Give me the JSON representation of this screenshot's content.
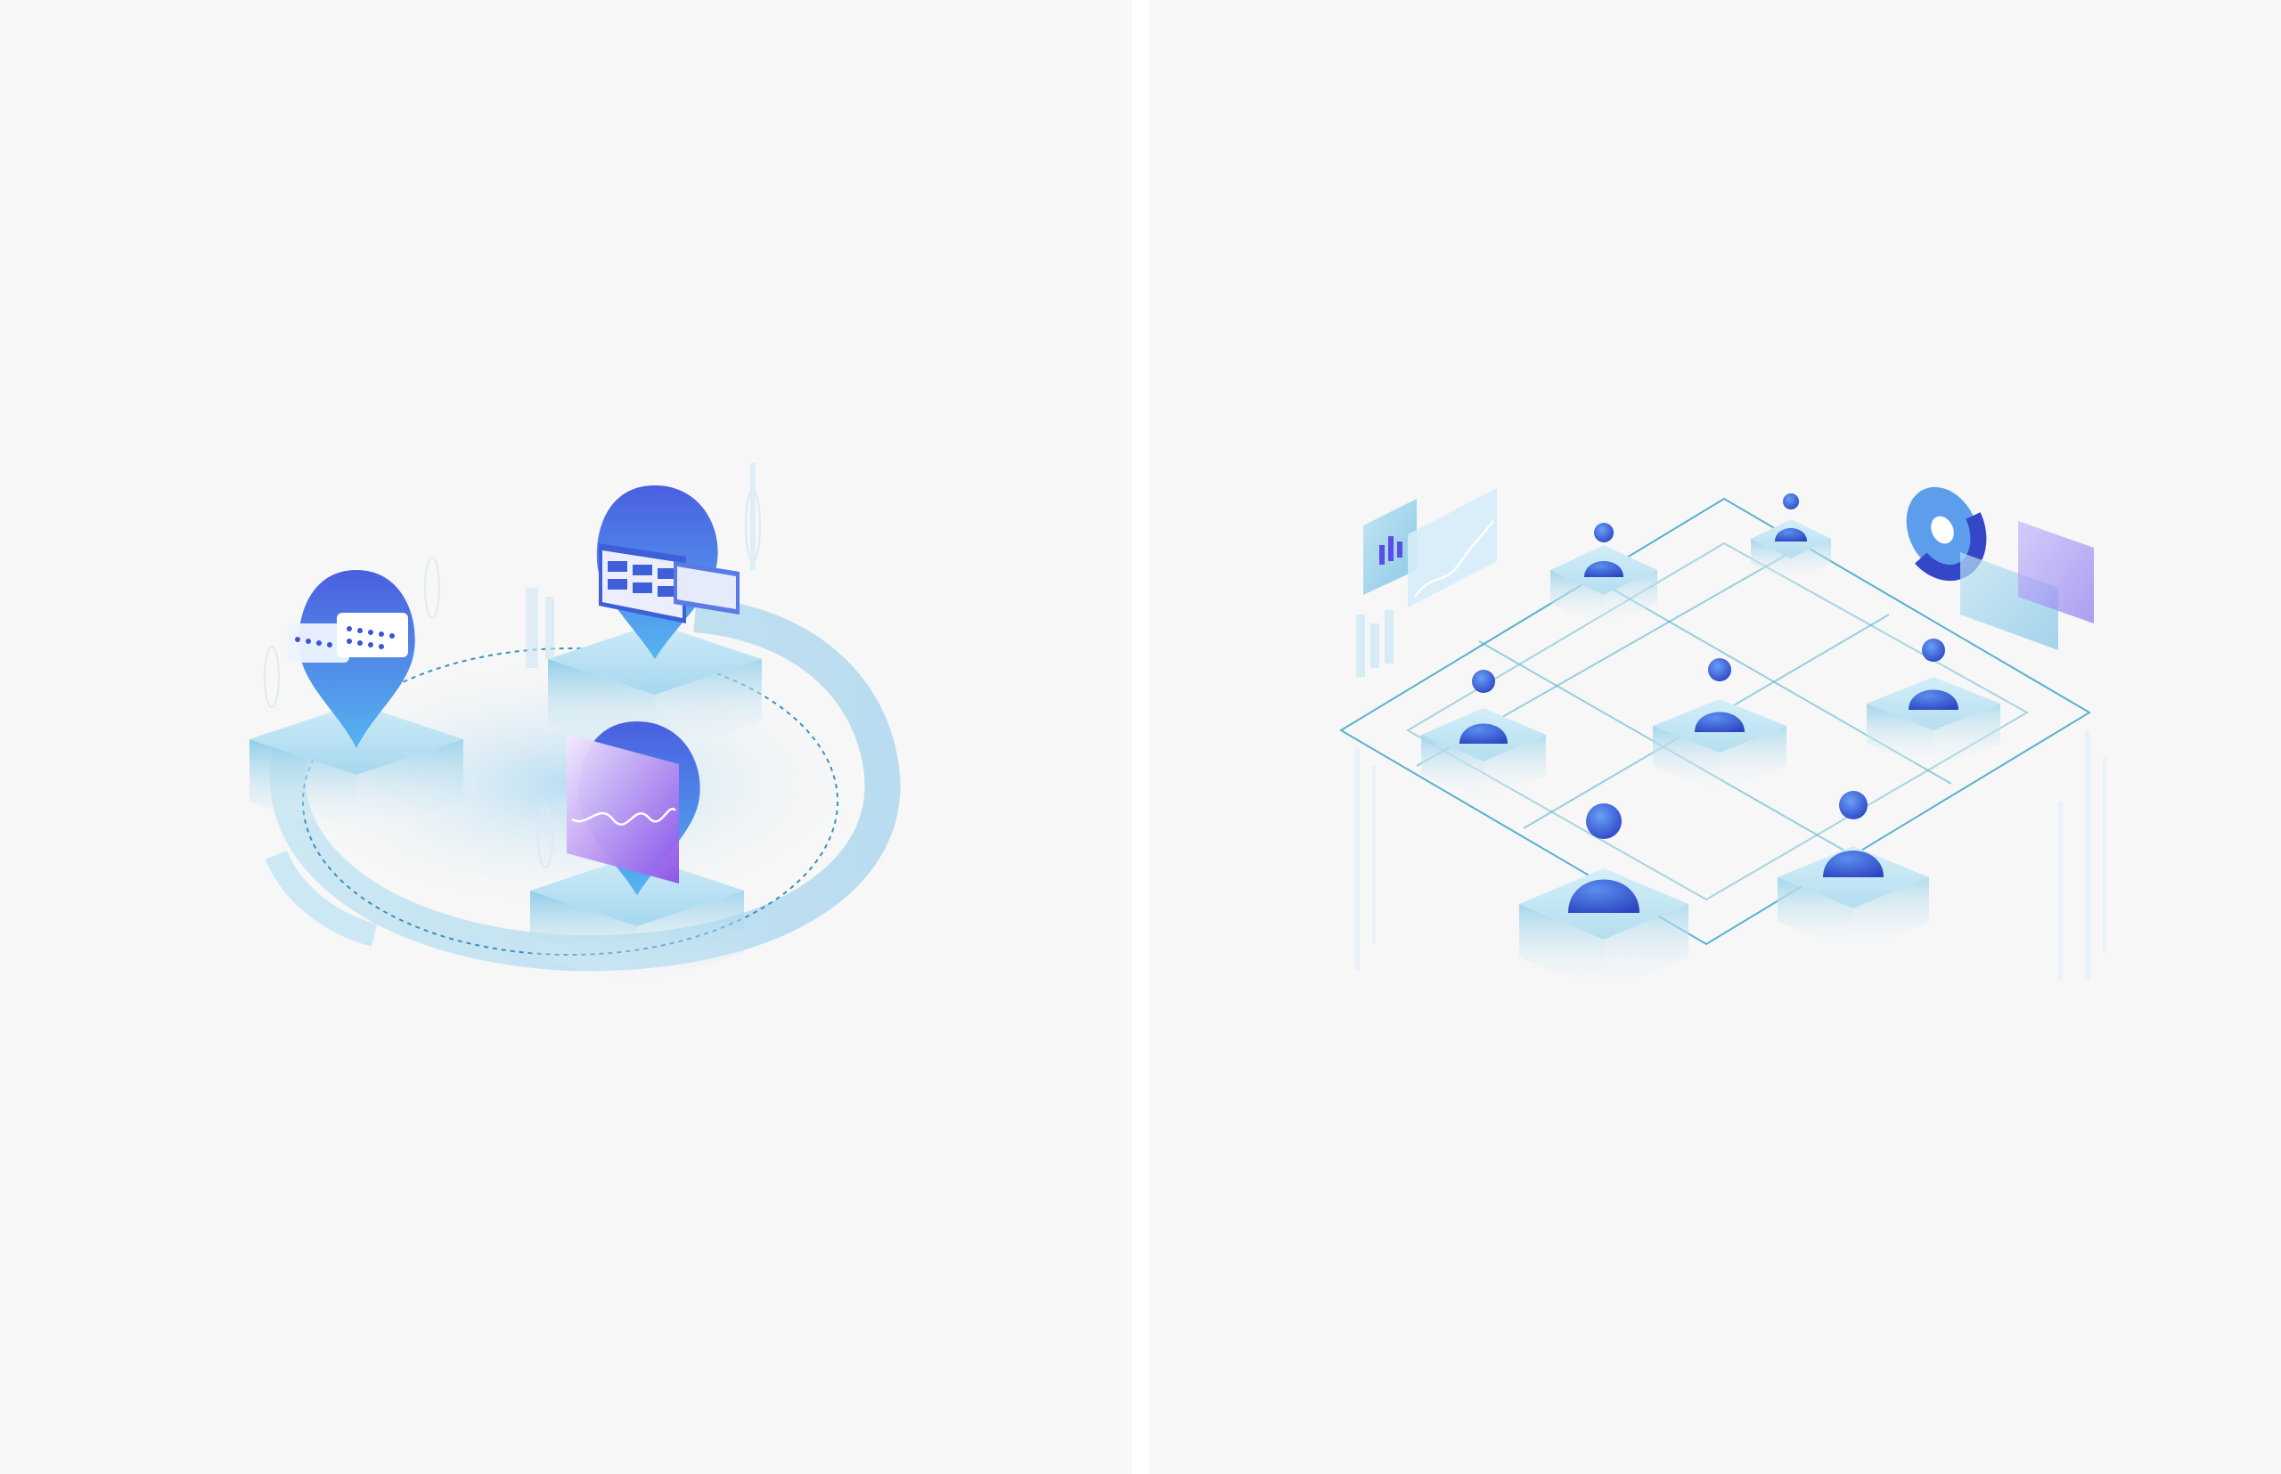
{
  "panels": [
    {
      "name": "left-illustration",
      "icons": [
        "chat-bubble-icon",
        "dashboard-window-icon",
        "line-chart-screen-icon"
      ],
      "background": "#f7f7f7"
    },
    {
      "name": "right-illustration",
      "icons": [
        "person-icon",
        "bar-chart-panel-icon",
        "donut-chart-panel-icon"
      ],
      "background": "#f7f7f7"
    }
  ],
  "colors": {
    "primary_blue": "#3a54d6",
    "light_blue": "#5aa8f0",
    "cyan": "#9fd8ec",
    "violet": "#8a4fe8",
    "line_teal": "#3aa7c4"
  }
}
